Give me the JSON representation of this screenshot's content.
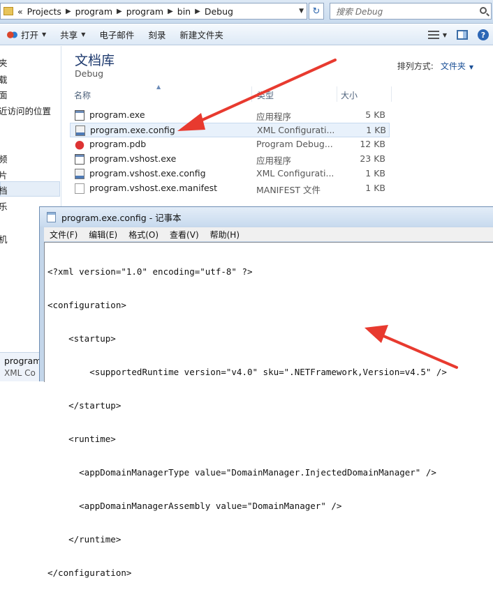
{
  "address": {
    "prefix": "«",
    "segments": [
      "Projects",
      "program",
      "program",
      "bin",
      "Debug"
    ],
    "search_placeholder": "搜索 Debug"
  },
  "toolbar": {
    "open": "打开",
    "share": "共享",
    "email": "电子邮件",
    "burn": "刻录",
    "new_folder": "新建文件夹"
  },
  "nav": {
    "items": [
      "夹",
      "载",
      "面",
      "近访问的位置",
      "",
      "频",
      "片",
      "档",
      "乐",
      "",
      "",
      "机"
    ]
  },
  "library": {
    "title": "文档库",
    "subtitle": "Debug",
    "arrange_label": "排列方式:",
    "arrange_value": "文件夹"
  },
  "columns": {
    "name": "名称",
    "type": "类型",
    "size": "大小"
  },
  "files": [
    {
      "name": "program.exe",
      "type": "应用程序",
      "size": "5 KB",
      "icon": "exe"
    },
    {
      "name": "program.exe.config",
      "type": "XML Configurati...",
      "size": "1 KB",
      "icon": "config"
    },
    {
      "name": "program.pdb",
      "type": "Program Debug...",
      "size": "12 KB",
      "icon": "pdb"
    },
    {
      "name": "program.vshost.exe",
      "type": "应用程序",
      "size": "23 KB",
      "icon": "exe"
    },
    {
      "name": "program.vshost.exe.config",
      "type": "XML Configurati...",
      "size": "1 KB",
      "icon": "config"
    },
    {
      "name": "program.vshost.exe.manifest",
      "type": "MANIFEST 文件",
      "size": "1 KB",
      "icon": "manifest"
    }
  ],
  "notepad": {
    "title": "program.exe.config - 记事本",
    "menu": [
      "文件(F)",
      "编辑(E)",
      "格式(O)",
      "查看(V)",
      "帮助(H)"
    ],
    "lines": [
      "<?xml version=\"1.0\" encoding=\"utf-8\" ?>",
      "<configuration>",
      "    <startup>",
      "        <supportedRuntime version=\"v4.0\" sku=\".NETFramework,Version=v4.5\" />",
      "    </startup>",
      "    <runtime>",
      "      <appDomainManagerType value=\"DomainManager.InjectedDomainManager\" />",
      "      <appDomainManagerAssembly value=\"DomainManager\" />",
      "    </runtime>",
      "</configuration>"
    ]
  },
  "details": {
    "name": "program",
    "type": "XML Co"
  },
  "colors": {
    "arrow": "#e83a2f",
    "title_blue": "#1e3a6e"
  }
}
